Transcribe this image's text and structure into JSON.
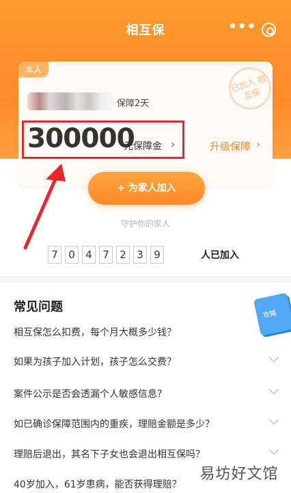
{
  "header": {
    "title": "相互保",
    "more_icon": "more-dots-icon",
    "close_icon": "circle-close-icon"
  },
  "card": {
    "tag": "本人",
    "stamp": "已加入 相互保",
    "guarantee_days": "保障2天",
    "amount": "300000",
    "amount_unit": "元保障金",
    "amount_chevron": "›",
    "upgrade": "升级保障",
    "upgrade_chevron": "›",
    "join_button": "+ 为家人加入",
    "guard_text": "守护你的家人"
  },
  "joined": {
    "digits": [
      "7",
      "0",
      "4",
      "7",
      "2",
      "3",
      "9"
    ],
    "label": "人已加入"
  },
  "faq": {
    "title": "常见问题",
    "book_label": "攻略",
    "items": [
      {
        "question": "相互保怎么扣费，每个月大概多少钱？"
      },
      {
        "question": "如果为孩子加入计划，孩子怎么交费？"
      },
      {
        "question": "案件公示是否会透漏个人敏感信息？"
      },
      {
        "question": "如已确诊保障范围内的重疾，理赔金额是多少？"
      },
      {
        "question": "理赔后退出，其名下子女也会退出相互保吗？"
      },
      {
        "question": "40岁加入，61岁患病，能否获得理赔？"
      }
    ]
  },
  "watermark": "易坊好文馆",
  "colors": {
    "accent": "#ff8a2a",
    "highlight_box": "#e8262c",
    "arrow": "#e8262c"
  }
}
